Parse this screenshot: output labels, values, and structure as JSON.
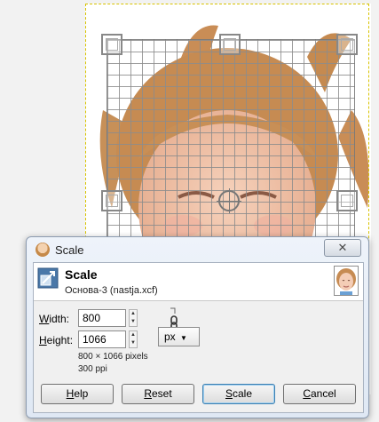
{
  "dialog": {
    "title": "Scale",
    "close_glyph": "✕",
    "header_title": "Scale",
    "header_subtitle": "Основа-3 (nastja.xcf)",
    "width_label_u": "W",
    "width_label_rest": "idth:",
    "height_label_u": "H",
    "height_label_rest": "eight:",
    "width_value": "800",
    "height_value": "1066",
    "unit": "px",
    "dims_text": "800 × 1066 pixels",
    "resolution_text": "300 ppi",
    "help_u": "H",
    "help_rest": "elp",
    "reset_u": "R",
    "reset_rest": "eset",
    "scale_u": "S",
    "scale_rest": "cale",
    "cancel_u": "C",
    "cancel_rest": "ancel"
  },
  "icons": {
    "title": "gimp-wilber-icon",
    "header": "scale-tool-icon",
    "chain": "chain-link-icon",
    "thumbnail": "image-thumbnail",
    "dropdown": "triangle-down-icon"
  },
  "colors": {
    "selection_dash": "#d8c300",
    "dialog_frame": "#8c9bb0",
    "default_button_border": "#3c7fb1"
  }
}
